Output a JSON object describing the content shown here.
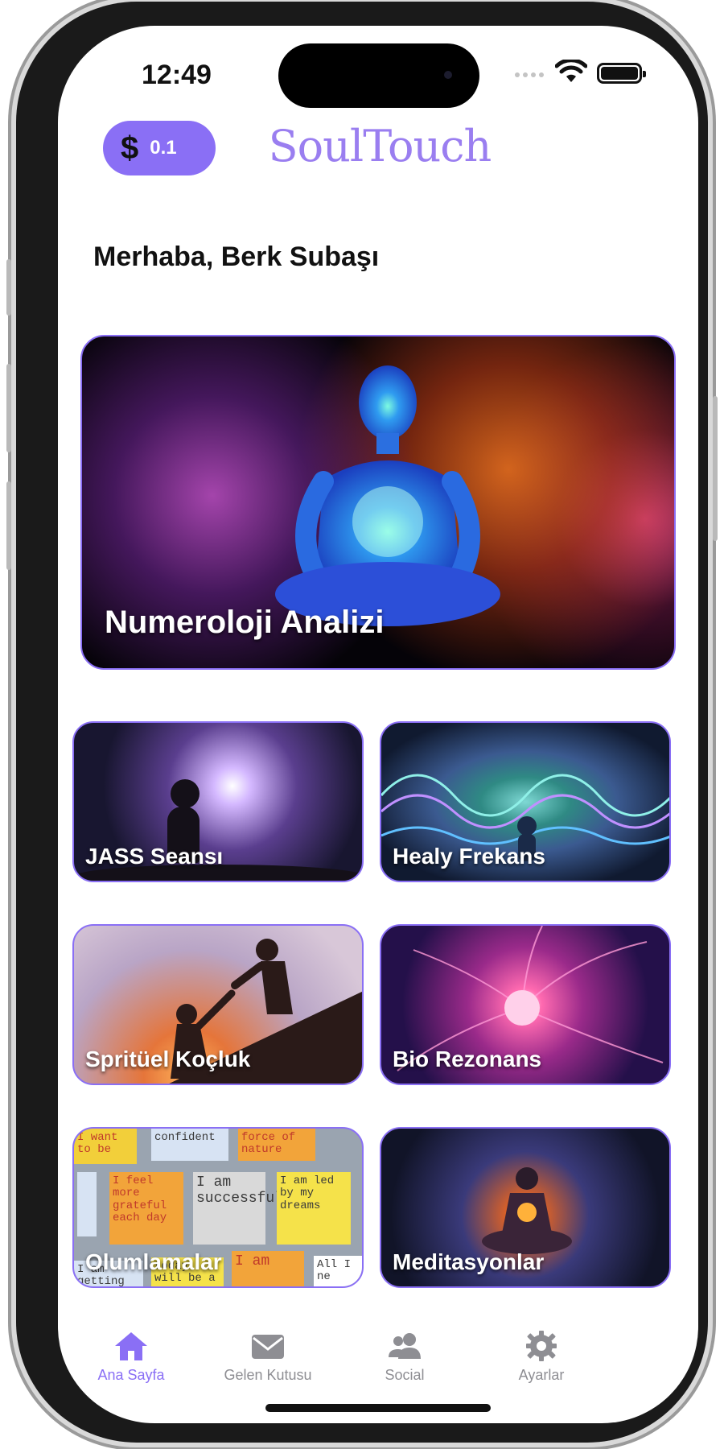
{
  "status_bar": {
    "time": "12:49"
  },
  "header": {
    "coin_symbol": "$",
    "coin_value": "0.1",
    "app_title": "SoulTouch"
  },
  "greeting": "Merhaba, Berk Subaşı",
  "hero": {
    "label": "Numeroloji Analizi"
  },
  "cards": [
    {
      "label": "JASS Seansı"
    },
    {
      "label": "Healy Frekans"
    },
    {
      "label": "Spritüel Koçluk"
    },
    {
      "label": "Bio Rezonans"
    },
    {
      "label": "Olumlamalar"
    },
    {
      "label": "Meditasyonlar"
    }
  ],
  "affirmation_notes": [
    "I want to be",
    "confident",
    "force of nature",
    "I feel more grateful each day",
    "I am successful",
    "I am led by my dreams",
    "I am",
    "today will be a",
    "I am getting",
    "All I ne"
  ],
  "tabs": [
    {
      "label": "Ana Sayfa",
      "icon": "home-icon"
    },
    {
      "label": "Gelen Kutusu",
      "icon": "mail-icon"
    },
    {
      "label": "Social",
      "icon": "people-icon"
    },
    {
      "label": "Ayarlar",
      "icon": "gear-icon"
    }
  ],
  "colors": {
    "accent": "#8a6ff5",
    "title": "#9a7ef0",
    "tab_inactive": "#8e8e93"
  }
}
